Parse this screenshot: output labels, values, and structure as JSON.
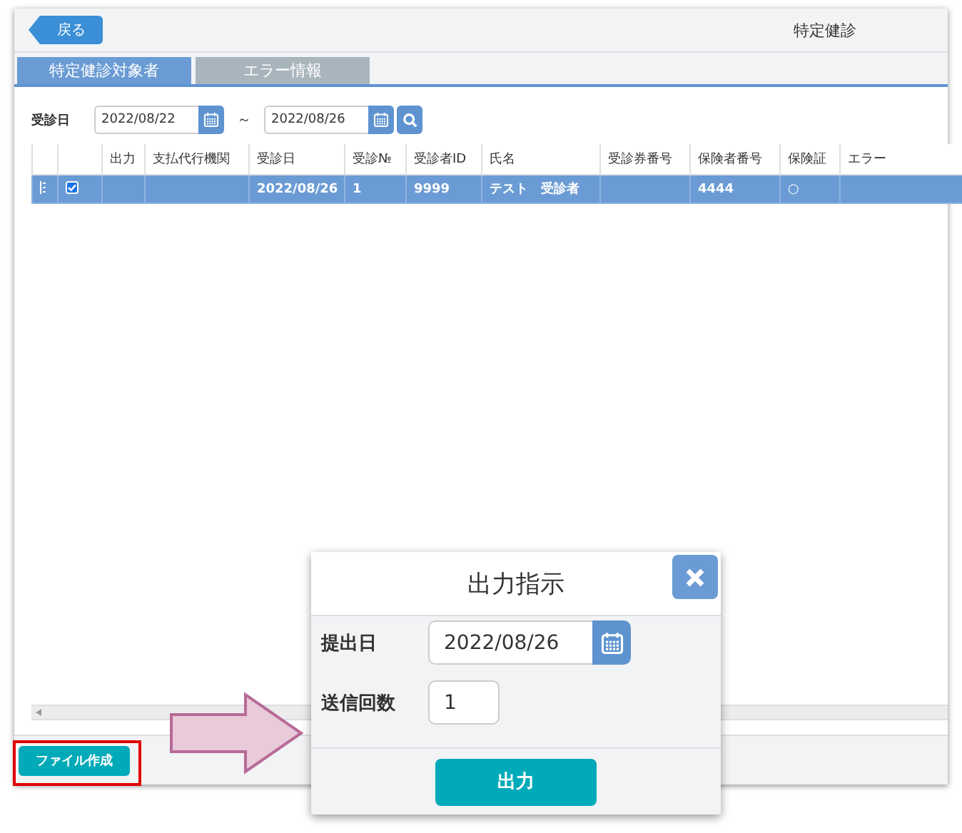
{
  "window": {
    "title": "特定健診",
    "back_button": "戻る"
  },
  "tabs": [
    {
      "label": "特定健診対象者",
      "selected": true
    },
    {
      "label": "エラー情報",
      "selected": false
    }
  ],
  "filter": {
    "label": "受診日",
    "from": "2022/08/22",
    "separator": "～",
    "to": "2022/08/26"
  },
  "table": {
    "columns": [
      "出力",
      "支払代行機関",
      "受診日",
      "受診№",
      "受診者ID",
      "氏名",
      "受診券番号",
      "保険者番号",
      "保険証",
      "エラー"
    ],
    "rows": [
      {
        "checked": true,
        "selected": true,
        "cells": [
          null,
          null,
          "2022/08/26",
          "1",
          "9999",
          "テスト　受診者",
          null,
          "4444",
          "○",
          null
        ]
      }
    ]
  },
  "footer": {
    "button": "ファイル作成"
  },
  "dialog": {
    "title": "出力指示",
    "fields": [
      {
        "kind": "date",
        "label": "提出日",
        "value": "2022/08/26"
      },
      {
        "kind": "number",
        "label": "送信回数",
        "value": "1"
      }
    ],
    "button": "出力"
  }
}
